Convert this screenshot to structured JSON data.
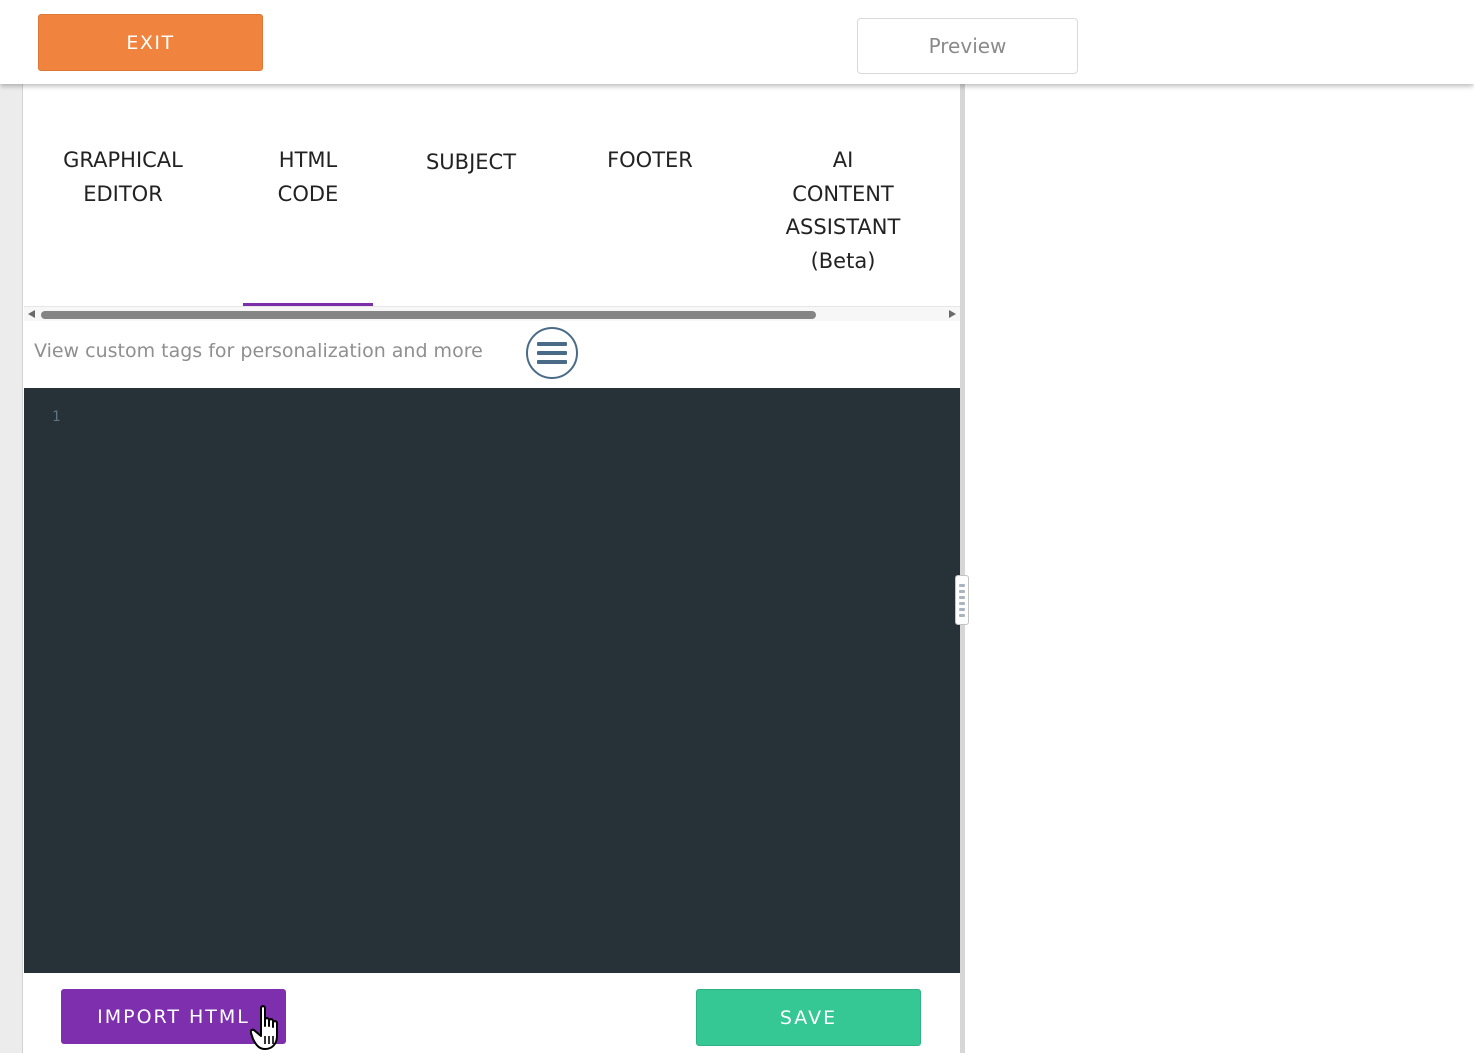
{
  "header": {
    "exit_label": "EXIT",
    "preview_label": "Preview"
  },
  "tabs": [
    {
      "label": "GRAPHICAL\nEDITOR",
      "active": false
    },
    {
      "label": "HTML\nCODE",
      "active": true
    },
    {
      "label": "SUBJECT",
      "active": false
    },
    {
      "label": "FOOTER",
      "active": false
    },
    {
      "label": "AI\nCONTENT\nASSISTANT\n(Beta)",
      "active": false
    }
  ],
  "custom_tags": {
    "text": "View custom tags for personalization and more",
    "icon": "menu-icon"
  },
  "code_editor": {
    "line_numbers": [
      "1"
    ],
    "background_color": "#263238"
  },
  "footer": {
    "import_label": "IMPORT HTML",
    "save_label": "SAVE"
  },
  "colors": {
    "exit": "#f0843f",
    "import": "#7e2fae",
    "save": "#35c895",
    "active_tab_underline": "#7b2fa8"
  },
  "pointer": {
    "icon": "hand-pointer-icon"
  }
}
